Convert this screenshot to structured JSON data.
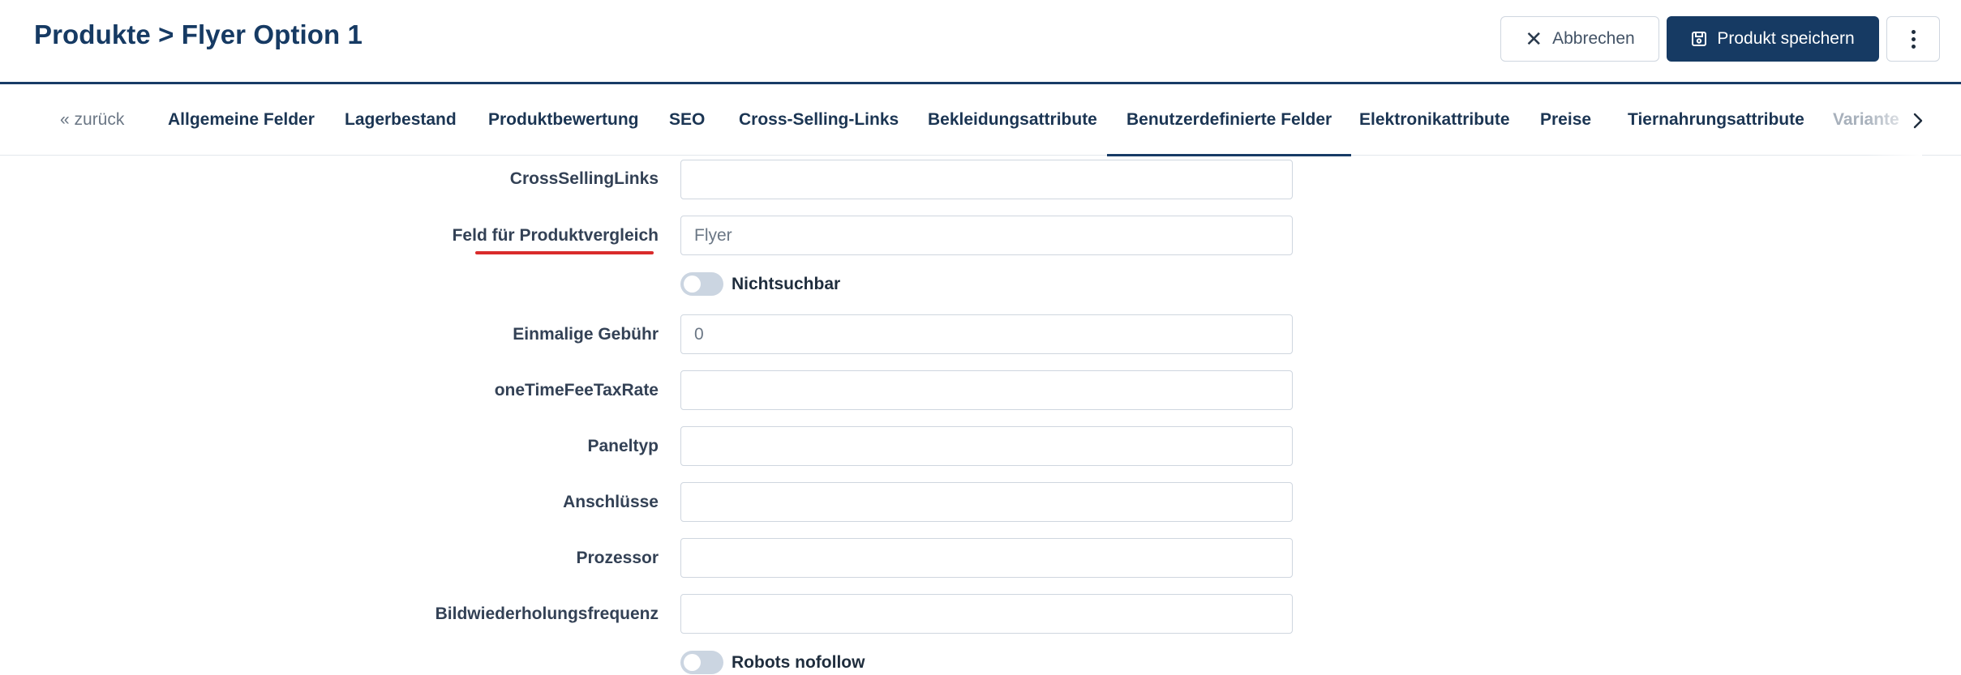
{
  "header": {
    "title": "Produkte > Flyer Option 1",
    "cancel_label": "Abbrechen",
    "save_label": "Produkt speichern"
  },
  "tabs": {
    "back": "« zurück",
    "items": [
      {
        "label": "Allgemeine Felder"
      },
      {
        "label": "Lagerbestand"
      },
      {
        "label": "Produktbewertung"
      },
      {
        "label": "SEO"
      },
      {
        "label": "Cross-Selling-Links"
      },
      {
        "label": "Bekleidungsattribute"
      },
      {
        "label": "Benutzerdefinierte Felder",
        "active": true
      },
      {
        "label": "Elektronikattribute"
      },
      {
        "label": "Preise"
      },
      {
        "label": "Tiernahrungsattribute"
      },
      {
        "label": "Variante"
      }
    ]
  },
  "form": {
    "cross_selling_links": {
      "label": "CrossSellingLinks",
      "value": ""
    },
    "compare_field": {
      "label": "Feld für Produktvergleich",
      "value": "Flyer"
    },
    "not_searchable": {
      "label": "Nichtsuchbar",
      "on": false
    },
    "one_time_fee": {
      "label": "Einmalige Gebühr",
      "value": "0"
    },
    "one_time_fee_tax": {
      "label": "oneTimeFeeTaxRate",
      "value": ""
    },
    "panel_type": {
      "label": "Paneltyp",
      "value": ""
    },
    "connections": {
      "label": "Anschlüsse",
      "value": ""
    },
    "processor": {
      "label": "Prozessor",
      "value": ""
    },
    "refresh_rate": {
      "label": "Bildwiederholungsfrequenz",
      "value": ""
    },
    "robots_nofollow": {
      "label": "Robots nofollow",
      "on": false
    }
  },
  "colors": {
    "primary": "#163a63",
    "highlight_underline": "#d92b2b",
    "toggle_off": "#cbd5e1"
  }
}
